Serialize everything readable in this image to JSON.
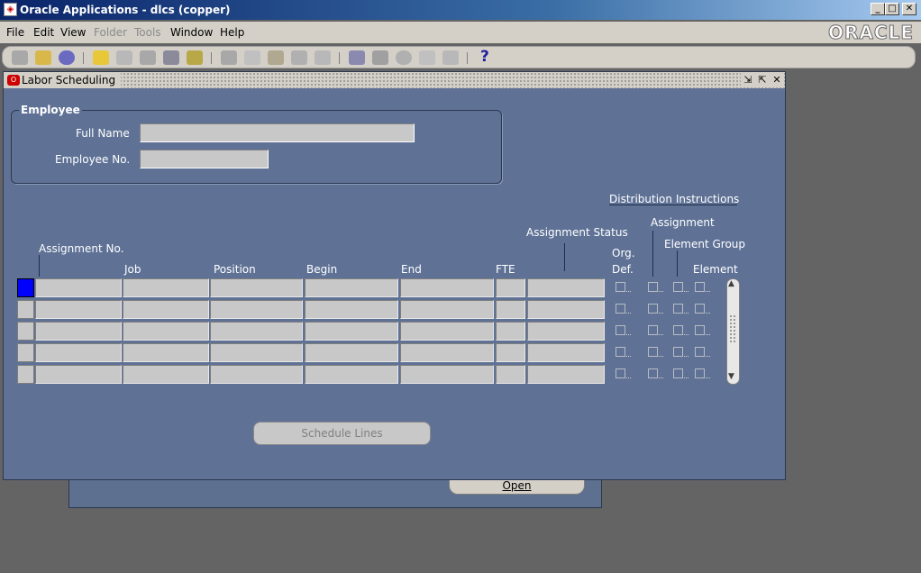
{
  "window": {
    "title": "Oracle Applications - dlcs (copper)",
    "min": "_",
    "max": "□",
    "close": "✕"
  },
  "menubar": {
    "items": [
      {
        "label": "File",
        "enabled": true
      },
      {
        "label": "Edit",
        "enabled": true
      },
      {
        "label": "View",
        "enabled": true
      },
      {
        "label": "Folder",
        "enabled": false
      },
      {
        "label": "Tools",
        "enabled": false
      },
      {
        "label": "Window",
        "enabled": true
      },
      {
        "label": "Help",
        "enabled": true
      }
    ],
    "logo": "ORACLE"
  },
  "toolbar": {
    "icons": [
      "new-icon",
      "find-icon",
      "navigator-icon",
      "save-icon",
      "next-step-icon",
      "switch-responsibility-icon",
      "print-icon",
      "close-form-icon",
      "cut-icon",
      "copy-icon",
      "paste-icon",
      "new-record-icon",
      "delete-record-icon",
      "edit-field-icon",
      "zoom-icon",
      "translations-icon",
      "attachments-icon",
      "folder-tools-icon",
      "help-icon"
    ],
    "help_glyph": "?"
  },
  "form": {
    "title": "Labor Scheduling",
    "employee": {
      "heading": "Employee",
      "full_name_label": "Full Name",
      "full_name_value": "",
      "employee_no_label": "Employee No.",
      "employee_no_value": ""
    },
    "distribution_instructions": "Distribution Instructions",
    "labels": {
      "assignment_no": "Assignment No.",
      "job": "Job",
      "position": "Position",
      "begin": "Begin",
      "end": "End",
      "fte": "FTE",
      "assignment_status": "Assignment Status",
      "org_def_line1": "Org.",
      "org_def_line2": "Def.",
      "assignment": "Assignment",
      "element_group": "Element Group",
      "element": "Element"
    },
    "rows": [
      {
        "assignment_no": "",
        "job": "",
        "position": "",
        "begin": "",
        "end": "",
        "fte": "",
        "status": ""
      },
      {
        "assignment_no": "",
        "job": "",
        "position": "",
        "begin": "",
        "end": "",
        "fte": "",
        "status": ""
      },
      {
        "assignment_no": "",
        "job": "",
        "position": "",
        "begin": "",
        "end": "",
        "fte": "",
        "status": ""
      },
      {
        "assignment_no": "",
        "job": "",
        "position": "",
        "begin": "",
        "end": "",
        "fte": "",
        "status": ""
      },
      {
        "assignment_no": "",
        "job": "",
        "position": "",
        "begin": "",
        "end": "",
        "fte": "",
        "status": ""
      }
    ],
    "schedule_lines_button": "Schedule Lines"
  },
  "background_window": {
    "open_button": "Open"
  },
  "colors": {
    "form_bg": "#5f7296",
    "field_bg": "#c8c8c8",
    "selected_record": "#0000ff",
    "title_bar": "#0a246a"
  }
}
